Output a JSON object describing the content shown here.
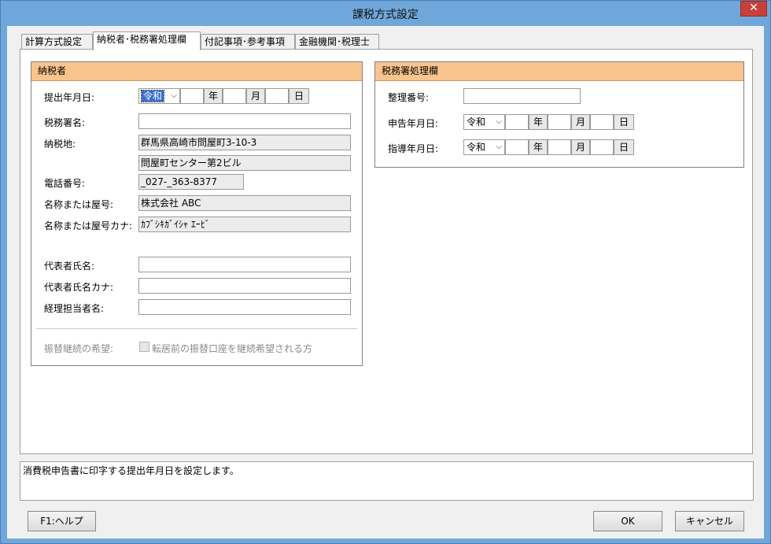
{
  "window": {
    "title": "課税方式設定",
    "close_glyph": "✕"
  },
  "tabs": [
    {
      "label": "計算方式設定"
    },
    {
      "label": "納税者･税務署処理欄"
    },
    {
      "label": "付記事項･参考事項"
    },
    {
      "label": "金融機関･税理士"
    }
  ],
  "taxpayer": {
    "header": "納税者",
    "submit_date": {
      "label": "提出年月日:",
      "era": "令和",
      "year_unit": "年",
      "month_unit": "月",
      "day_unit": "日"
    },
    "tax_office": {
      "label": "税務署名:",
      "value": ""
    },
    "address": {
      "label": "納税地:",
      "line1": "群馬県高崎市問屋町3-10-3",
      "line2": "問屋町センター第2ビル"
    },
    "phone": {
      "label": "電話番号:",
      "value": "_027-_363-8377"
    },
    "name": {
      "label": "名称または屋号:",
      "value": "株式会社 ABC"
    },
    "name_kana": {
      "label": "名称または屋号カナ:",
      "value": "ｶﾌﾞｼｷｶﾞｲｼｬ ｴｰﾋﾞ"
    },
    "rep_name": {
      "label": "代表者氏名:",
      "value": ""
    },
    "rep_kana": {
      "label": "代表者氏名カナ:",
      "value": ""
    },
    "accountant": {
      "label": "経理担当者名:",
      "value": ""
    },
    "transfer": {
      "label": "振替継続の希望:",
      "checkbox_label": "転居前の振替口座を継続希望される方"
    }
  },
  "tax_office_section": {
    "header": "税務署処理欄",
    "ref_no": {
      "label": "整理番号:",
      "value": ""
    },
    "report_date": {
      "label": "申告年月日:",
      "era": "令和",
      "year_unit": "年",
      "month_unit": "月",
      "day_unit": "日"
    },
    "guidance_date": {
      "label": "指導年月日:",
      "era": "令和",
      "year_unit": "年",
      "month_unit": "月",
      "day_unit": "日"
    }
  },
  "status_text": "消費税申告書に印字する提出年月日を設定します。",
  "buttons": {
    "help": "F1:ヘルプ",
    "ok": "OK",
    "cancel": "キャンセル"
  },
  "icons": {
    "dropdown": "chevron-down-icon",
    "close": "close-icon"
  }
}
